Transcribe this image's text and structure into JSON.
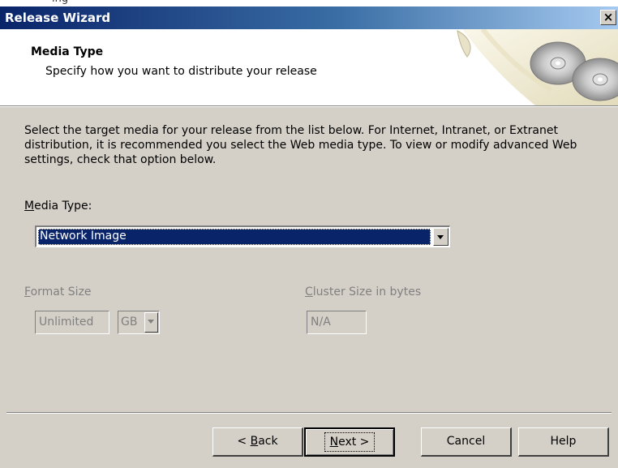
{
  "background_window_title_fragment": "ing",
  "window": {
    "title": "Release Wizard",
    "close_glyph": "×"
  },
  "header": {
    "title": "Media Type",
    "subtitle": "Specify how you want to distribute your release",
    "art_icon": "cd-discs-scroll-icon"
  },
  "instructions": "Select the target media for your release from the list below. For Internet, Intranet, or Extranet distribution, it is recommended you select the Web media type. To view or modify advanced Web settings, check that option below.",
  "media_type": {
    "label_mnemonic": "M",
    "label_rest": "edia Type:",
    "selected": "Network Image"
  },
  "format_size": {
    "label_mnemonic": "F",
    "label_rest": "ormat Size",
    "value": "Unlimited",
    "unit": "GB"
  },
  "cluster_size": {
    "label_mnemonic": "C",
    "label_rest": "luster Size in bytes",
    "value": "N/A"
  },
  "buttons": {
    "back_prefix": "< ",
    "back_mnemonic": "B",
    "back_rest": "ack",
    "next_mnemonic": "N",
    "next_rest": "ext >",
    "cancel": "Cancel",
    "help": "Help"
  },
  "colors": {
    "dialog_face": "#d4d0c8",
    "titlebar_start": "#0a246a",
    "titlebar_end": "#a6caf0",
    "selection": "#0a246a",
    "disabled_text": "#808080"
  }
}
